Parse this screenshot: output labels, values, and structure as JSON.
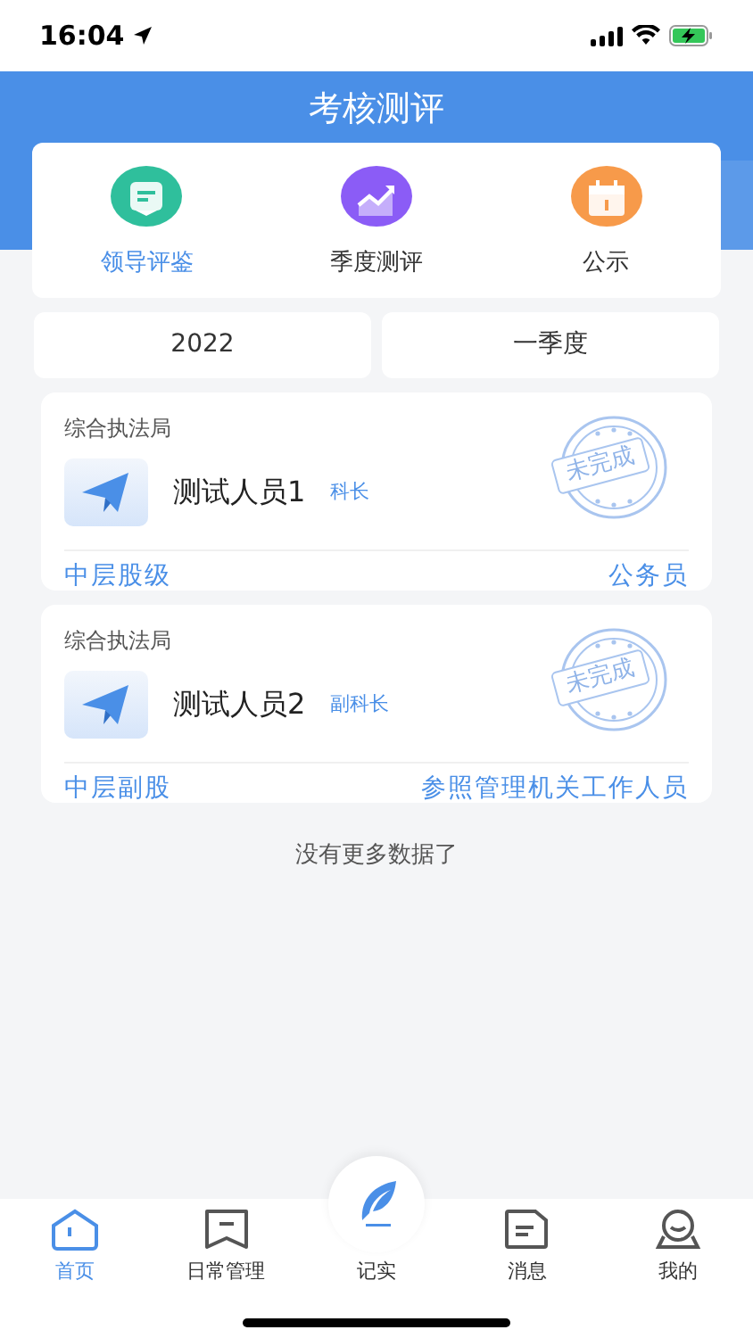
{
  "status_bar": {
    "time": "16:04"
  },
  "header": {
    "title": "考核测评"
  },
  "shortcuts": [
    {
      "label": "领导评鉴",
      "color": "#2fbf9c",
      "selected": true
    },
    {
      "label": "季度测评",
      "color": "#8b5cf6",
      "selected": false
    },
    {
      "label": "公示",
      "color": "#f79a4a",
      "selected": false
    }
  ],
  "filters": [
    {
      "value": "2022"
    },
    {
      "value": "一季度"
    }
  ],
  "records": [
    {
      "department": "综合执法局",
      "name": "测试人员1",
      "position": "科长",
      "stamp": "未完成",
      "level": "中层股级",
      "category": "公务员"
    },
    {
      "department": "综合执法局",
      "name": "测试人员2",
      "position": "副科长",
      "stamp": "未完成",
      "level": "中层副股",
      "category": "参照管理机关工作人员"
    }
  ],
  "end_note": "没有更多数据了",
  "tab_bar": [
    {
      "label": "首页",
      "kind": "home",
      "selected": true
    },
    {
      "label": "日常管理",
      "kind": "manage",
      "selected": false
    },
    {
      "label": "记实",
      "kind": "record",
      "selected": false
    },
    {
      "label": "消息",
      "kind": "message",
      "selected": false
    },
    {
      "label": "我的",
      "kind": "profile",
      "selected": false
    }
  ]
}
